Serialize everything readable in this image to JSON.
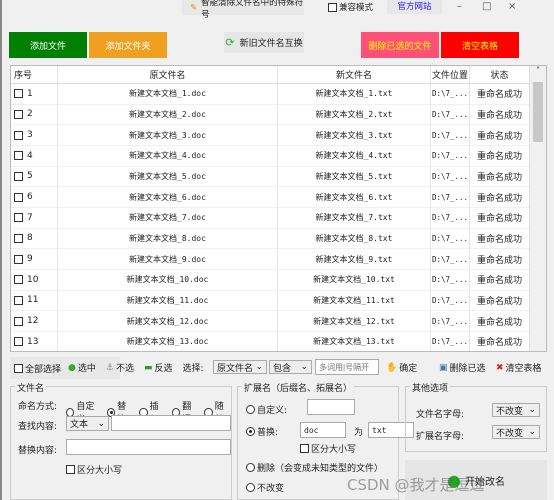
{
  "title": {
    "text": "智能清除文件名中的特殊符号",
    "compat_label": "兼容模式",
    "site_link": "官方网站",
    "minimize": "–",
    "maximize": "□",
    "close": "×"
  },
  "buttons": {
    "add_file": "添加文件",
    "add_folder": "添加文件夹",
    "swap_names": "新旧文件名互换",
    "delete_selected_files": "删除已选的文件",
    "clear_table": "清空表格"
  },
  "colors": {
    "add_file": "#008000",
    "add_folder": "#f0a020",
    "delete": "#ff5078",
    "clear": "#ff0000",
    "delete_text": "#ffff00"
  },
  "table": {
    "headers": [
      "序号",
      "原文件名",
      "新文件名",
      "文件位置",
      "状态"
    ],
    "rows": [
      [
        "1",
        "新建文本文档_1.doc",
        "新建文本文档_1.txt",
        "D:\\7_...",
        "重命名成功"
      ],
      [
        "2",
        "新建文本文档_2.doc",
        "新建文本文档_2.txt",
        "D:\\7_...",
        "重命名成功"
      ],
      [
        "3",
        "新建文本文档_3.doc",
        "新建文本文档_3.txt",
        "D:\\7_...",
        "重命名成功"
      ],
      [
        "4",
        "新建文本文档_4.doc",
        "新建文本文档_4.txt",
        "D:\\7_...",
        "重命名成功"
      ],
      [
        "5",
        "新建文本文档_5.doc",
        "新建文本文档_5.txt",
        "D:\\7_...",
        "重命名成功"
      ],
      [
        "6",
        "新建文本文档_6.doc",
        "新建文本文档_6.txt",
        "D:\\7_...",
        "重命名成功"
      ],
      [
        "7",
        "新建文本文档_7.doc",
        "新建文本文档_7.txt",
        "D:\\7_...",
        "重命名成功"
      ],
      [
        "8",
        "新建文本文档_8.doc",
        "新建文本文档_8.txt",
        "D:\\7_...",
        "重命名成功"
      ],
      [
        "9",
        "新建文本文档_9.doc",
        "新建文本文档_9.txt",
        "D:\\7_...",
        "重命名成功"
      ],
      [
        "10",
        "新建文本文档_10.doc",
        "新建文本文档_10.txt",
        "D:\\7_...",
        "重命名成功"
      ],
      [
        "11",
        "新建文本文档_11.doc",
        "新建文本文档_11.txt",
        "D:\\7_...",
        "重命名成功"
      ],
      [
        "12",
        "新建文本文档_12.doc",
        "新建文本文档_12.txt",
        "D:\\7_...",
        "重命名成功"
      ],
      [
        "13",
        "新建文本文档_13.doc",
        "新建文本文档_13.txt",
        "D:\\7_...",
        "重命名成功"
      ]
    ]
  },
  "toolbar": {
    "select_all": "全部选择",
    "check": "选中",
    "uncheck": "不选",
    "invert": "反选",
    "select_label": "选择:",
    "field_value": "原文件名",
    "match_value": "包含",
    "keyword_placeholder": "多词用|号隔开",
    "confirm": "确定",
    "delete_checked": "删除已选",
    "clear": "清空表格"
  },
  "filename_group": {
    "title": "文件名",
    "naming_label": "命名方式:",
    "modes": [
      "自定义",
      "替换",
      "插入",
      "翻译",
      "随机"
    ],
    "selected_mode": "替换",
    "find_label": "查找内容:",
    "find_type": "文本",
    "find_value": "",
    "replace_label": "替换内容:",
    "replace_value": "",
    "case_label": "区分大小写"
  },
  "ext_group": {
    "title": "扩展名（后缀名、拓展名）",
    "custom_label": "自定义:",
    "custom_value": "",
    "replace_label": "普换:",
    "from_value": "doc",
    "to_label": "为",
    "to_value": "txt",
    "case_label": "区分大小写",
    "delete_label": "删除（会变成未知类型的文件）",
    "keep_label": "不改变",
    "selected": "replace"
  },
  "other_group": {
    "title": "其他选项",
    "name_case_label": "文件名字母:",
    "name_case_value": "不改变",
    "ext_case_label": "扩展名字母:",
    "ext_case_value": "不改变"
  },
  "start_button": "开始改名",
  "watermark": "CSDN @我才是逗逗"
}
